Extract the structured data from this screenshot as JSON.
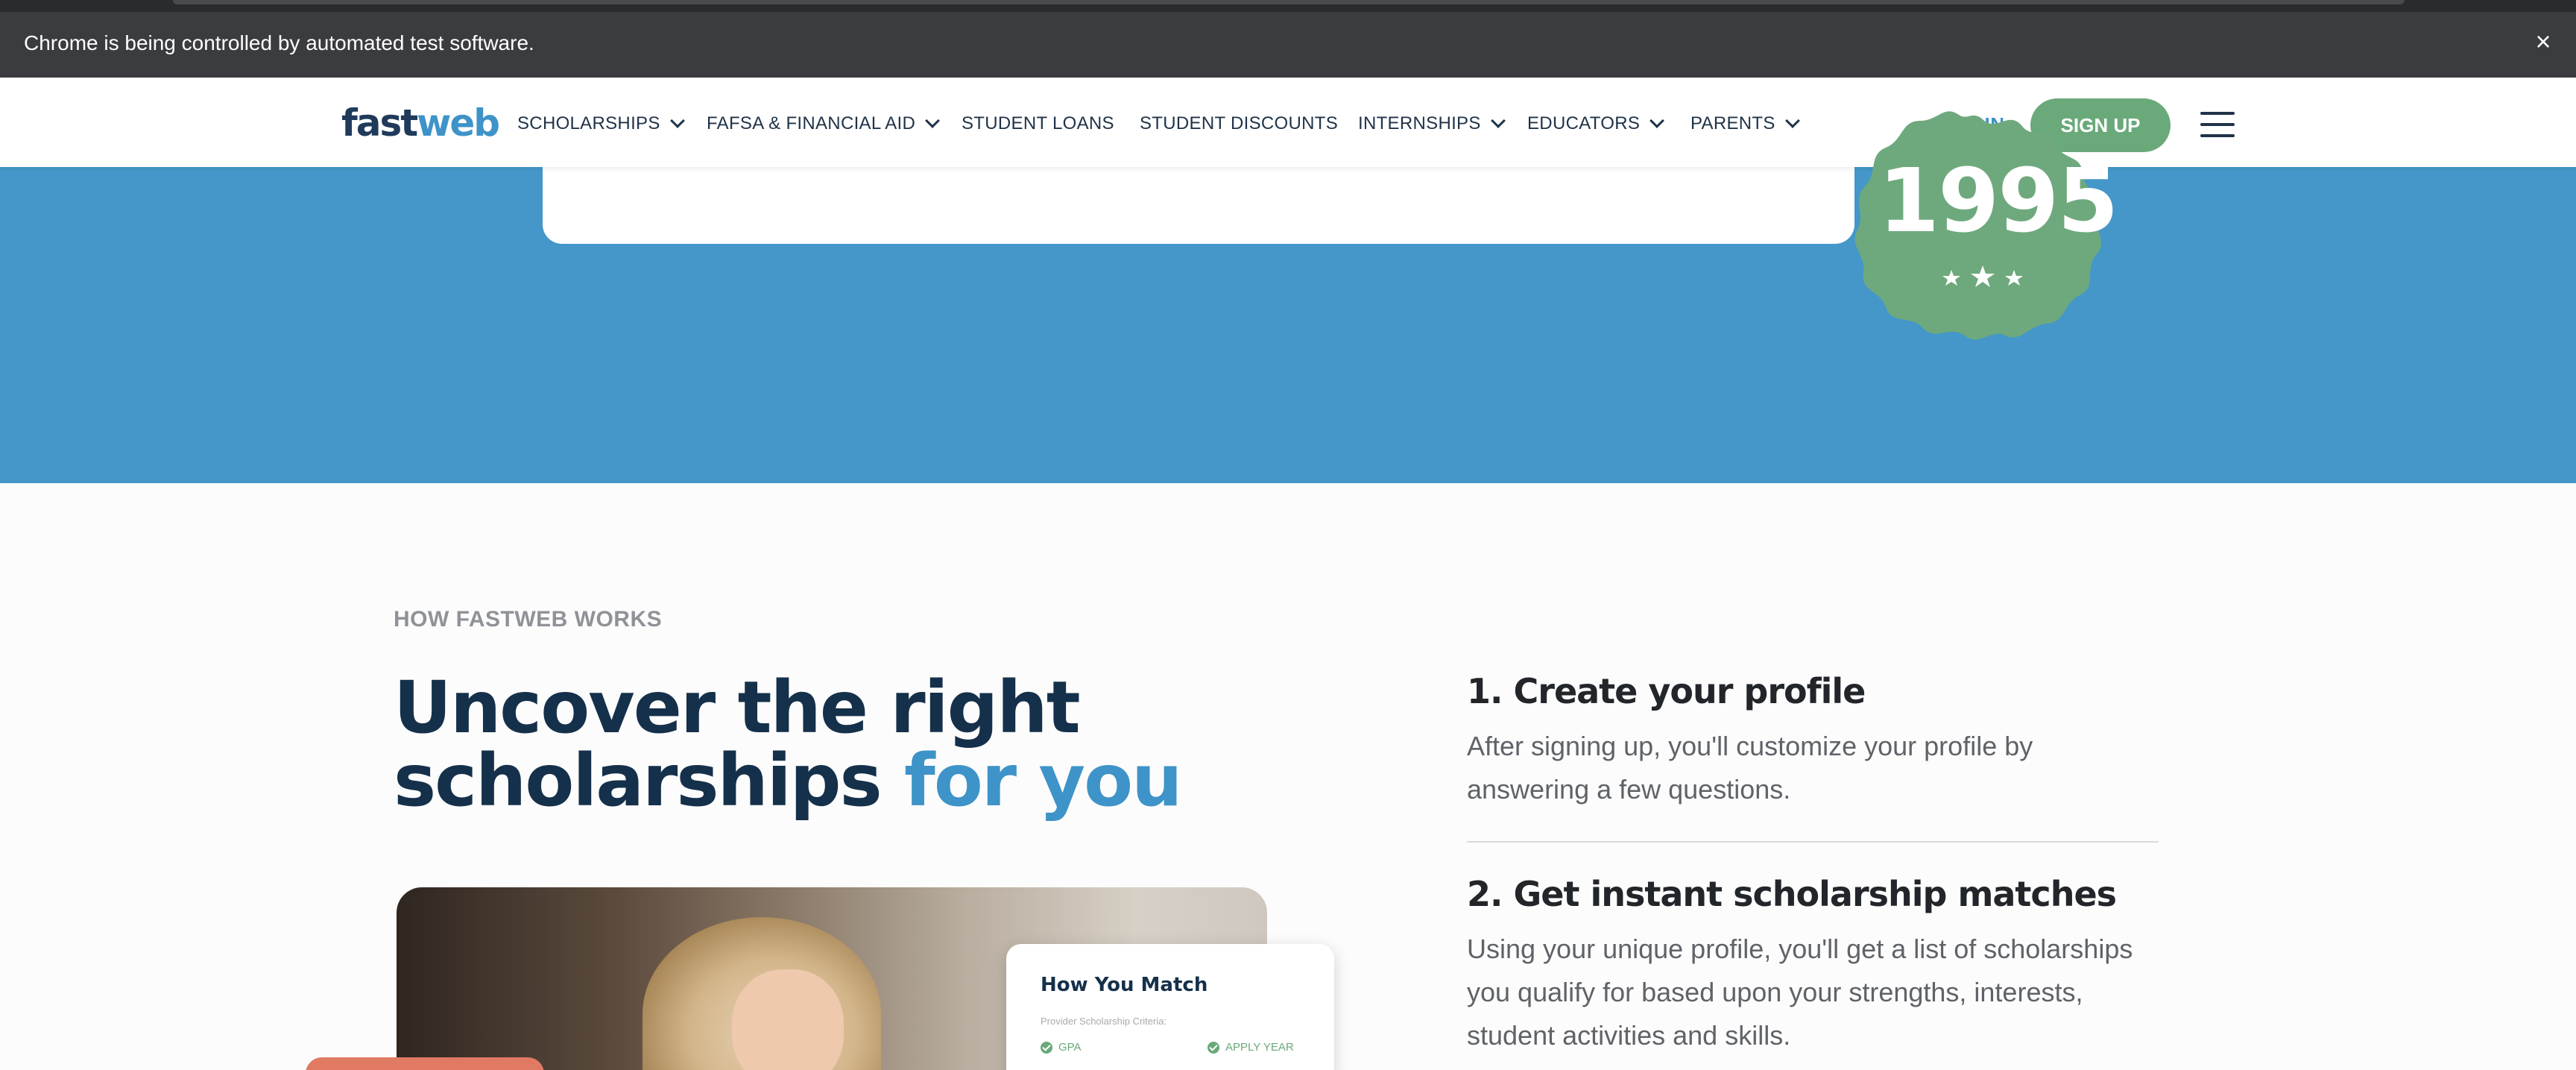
{
  "browser": {
    "infobar_message": "Chrome is being controlled by automated test software.",
    "close_symbol": "×"
  },
  "header": {
    "logo_part1": "fast",
    "logo_part2": "web",
    "nav": [
      {
        "label": "SCHOLARSHIPS",
        "has_dropdown": true
      },
      {
        "label": "FAFSA & FINANCIAL AID",
        "has_dropdown": true
      },
      {
        "label": "STUDENT LOANS",
        "has_dropdown": false
      },
      {
        "label": "STUDENT DISCOUNTS",
        "has_dropdown": false
      },
      {
        "label": "INTERNSHIPS",
        "has_dropdown": true
      },
      {
        "label": "EDUCATORS",
        "has_dropdown": true
      },
      {
        "label": "PARENTS",
        "has_dropdown": true
      }
    ],
    "login_label": "LOG IN",
    "signup_label": "SIGN UP",
    "menu_icon": "hamburger-icon"
  },
  "hero": {
    "badge_year": "1995",
    "badge_stars": 3
  },
  "how_it_works": {
    "eyebrow": "HOW FASTWEB WORKS",
    "headline_line1": "Uncover the right",
    "headline_line2_dark": "scholarships ",
    "headline_line2_accent": "for you",
    "match_card": {
      "title": "How You Match",
      "criteria_label": "Provider Scholarship Criteria:",
      "tags": [
        "GPA",
        "APPLY YEAR"
      ]
    },
    "steps": [
      {
        "title": "1. Create your profile",
        "description": "After signing up, you'll customize your profile by answering a few questions."
      },
      {
        "title": "2. Get instant scholarship matches",
        "description": "Using your unique profile, you'll get a list of scholarships you qualify for based upon your strengths, interests, student activities and skills."
      }
    ]
  },
  "colors": {
    "brand_dark": "#1f3a5a",
    "brand_blue": "#3e93c8",
    "hero_blue": "#4497c8",
    "green": "#6aa97a",
    "infobar_bg": "#3b3c3f"
  }
}
